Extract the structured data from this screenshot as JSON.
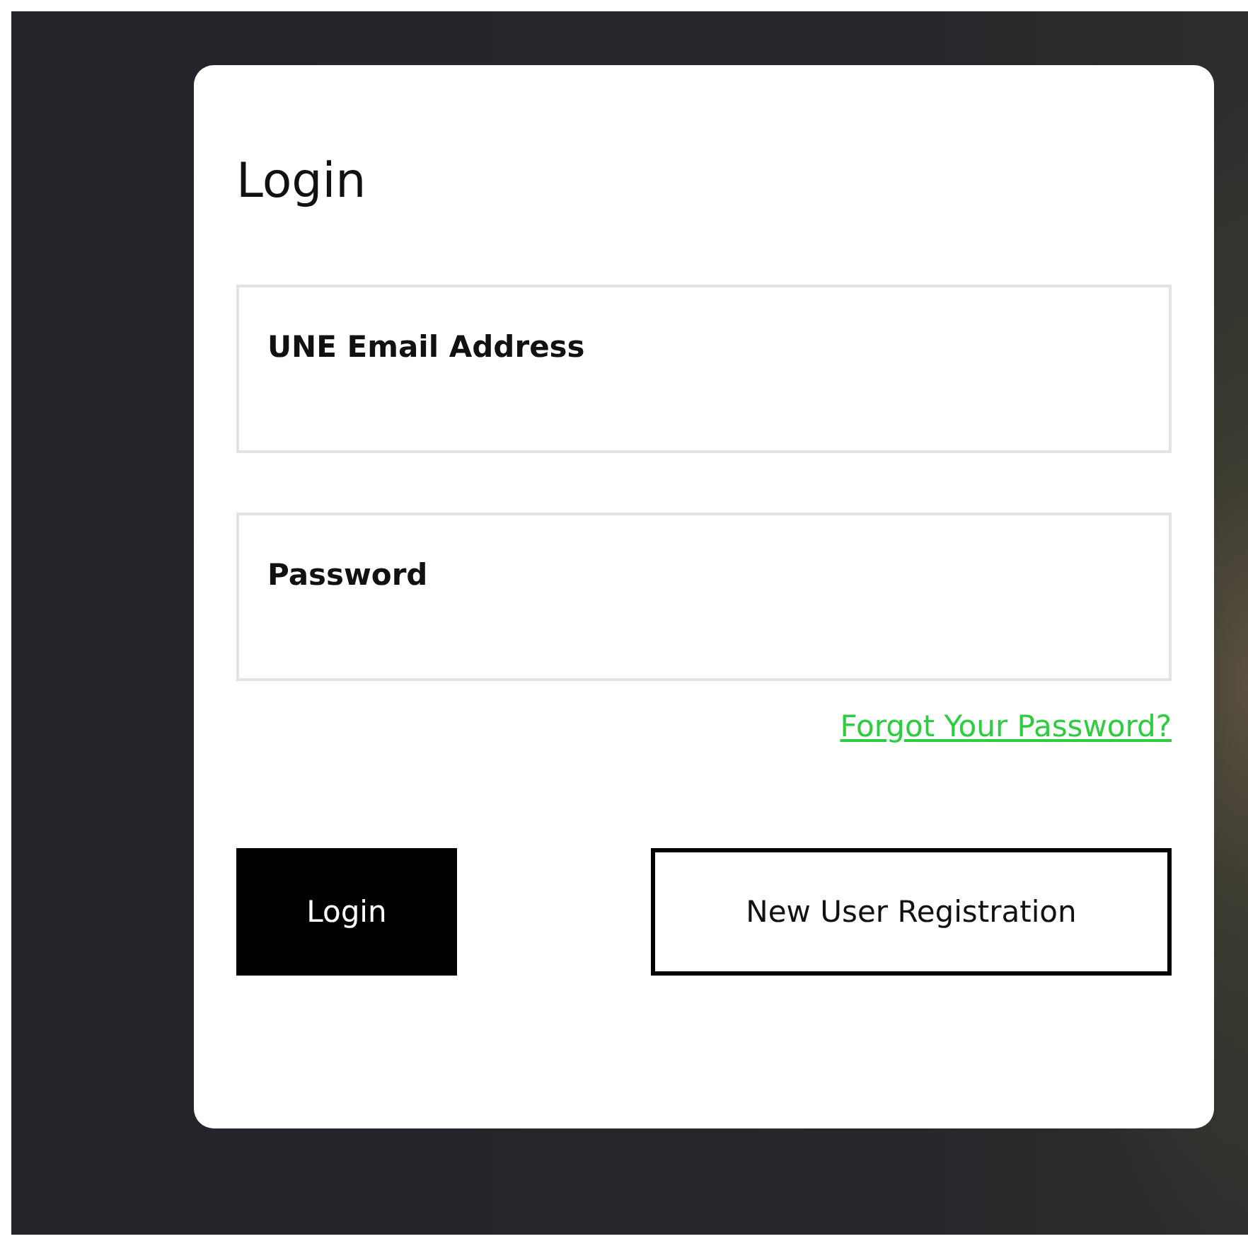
{
  "login_card": {
    "title": "Login",
    "fields": [
      {
        "label": "UNE Email Address"
      },
      {
        "label": "Password"
      }
    ],
    "forgot_link": "Forgot Your Password?",
    "buttons": [
      {
        "label": "Login",
        "kind": "primary"
      },
      {
        "label": "New User Registration",
        "kind": "outline"
      }
    ]
  }
}
